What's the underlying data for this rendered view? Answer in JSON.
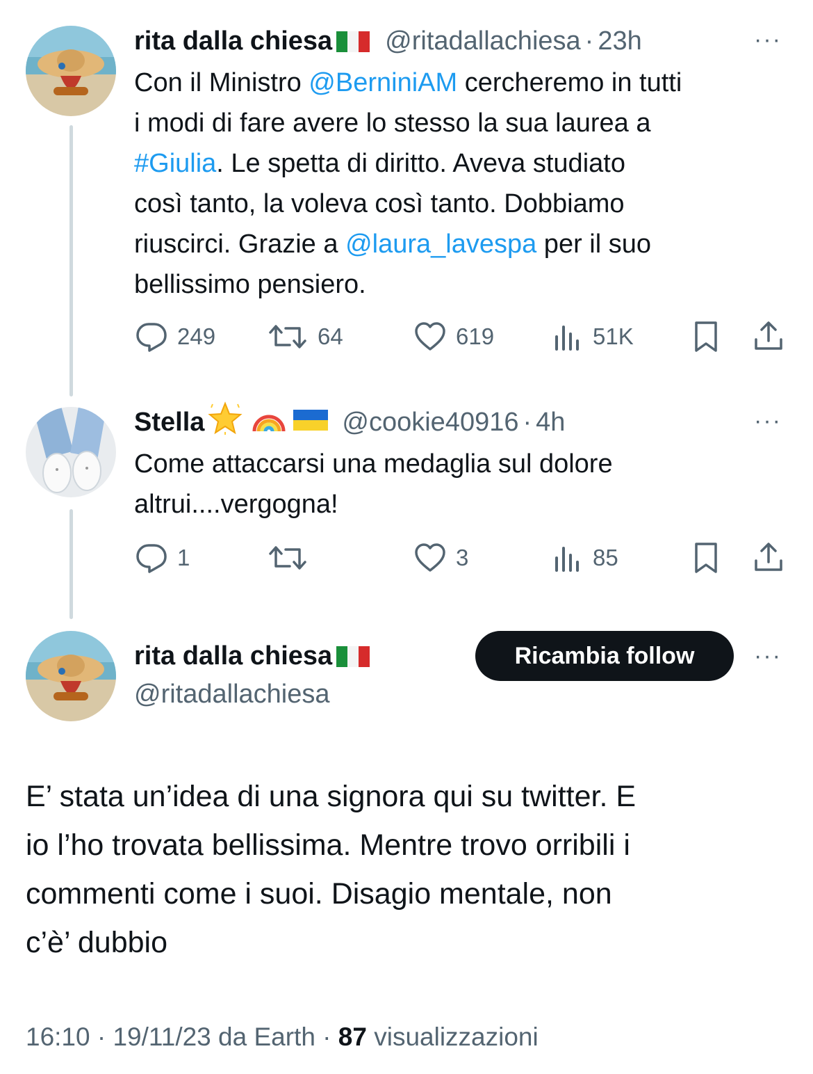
{
  "tweet1": {
    "name": "rita dalla chiesa",
    "flag": "italy-flag",
    "handle": "@ritadallachiesa",
    "sep": "·",
    "time": "23h",
    "text_parts": [
      "Con il Ministro ",
      "@BerniniAM",
      " cercheremo in tutti",
      "i modi di fare avere lo stesso la sua laurea a",
      "#Giulia",
      ". Le spetta di diritto. Aveva studiato",
      "così tanto, la voleva così tanto. Dobbiamo",
      "riuscirci. Grazie a ",
      "@laura_lavespa",
      " per il suo",
      "bellissimo pensiero."
    ],
    "replies": "249",
    "retweets": "64",
    "likes": "619",
    "views": "51K"
  },
  "tweet2": {
    "name": "Stella",
    "emojis": [
      "glowing-star",
      "rainbow",
      "ukraine-flag"
    ],
    "handle": "@cookie40916",
    "sep": "·",
    "time": "4h",
    "text_line1": "Come attaccarsi una medaglia sul dolore",
    "text_line2": "altrui....vergogna!",
    "replies": "1",
    "likes": "3",
    "views": "85"
  },
  "tweet3": {
    "name": "rita dalla chiesa",
    "flag": "italy-flag",
    "handle": "@ritadallachiesa",
    "follow_label": "Ricambia follow",
    "text_lines": [
      "E’ stata un’idea di una signora qui su twitter. E",
      "io l’ho trovata bellissima. Mentre trovo orribili i",
      "commenti come i suoi. Disagio mentale, non",
      "c’è’ dubbio"
    ],
    "meta_prefix": "16:10 · 19/11/23 da Earth · ",
    "views_count": "87",
    "views_label": " visualizzazioni"
  },
  "more_label": "···",
  "colors": {
    "link": "#1d9bf0",
    "muted": "#536471",
    "text": "#0f1419",
    "thread_line": "#cfd9de"
  }
}
